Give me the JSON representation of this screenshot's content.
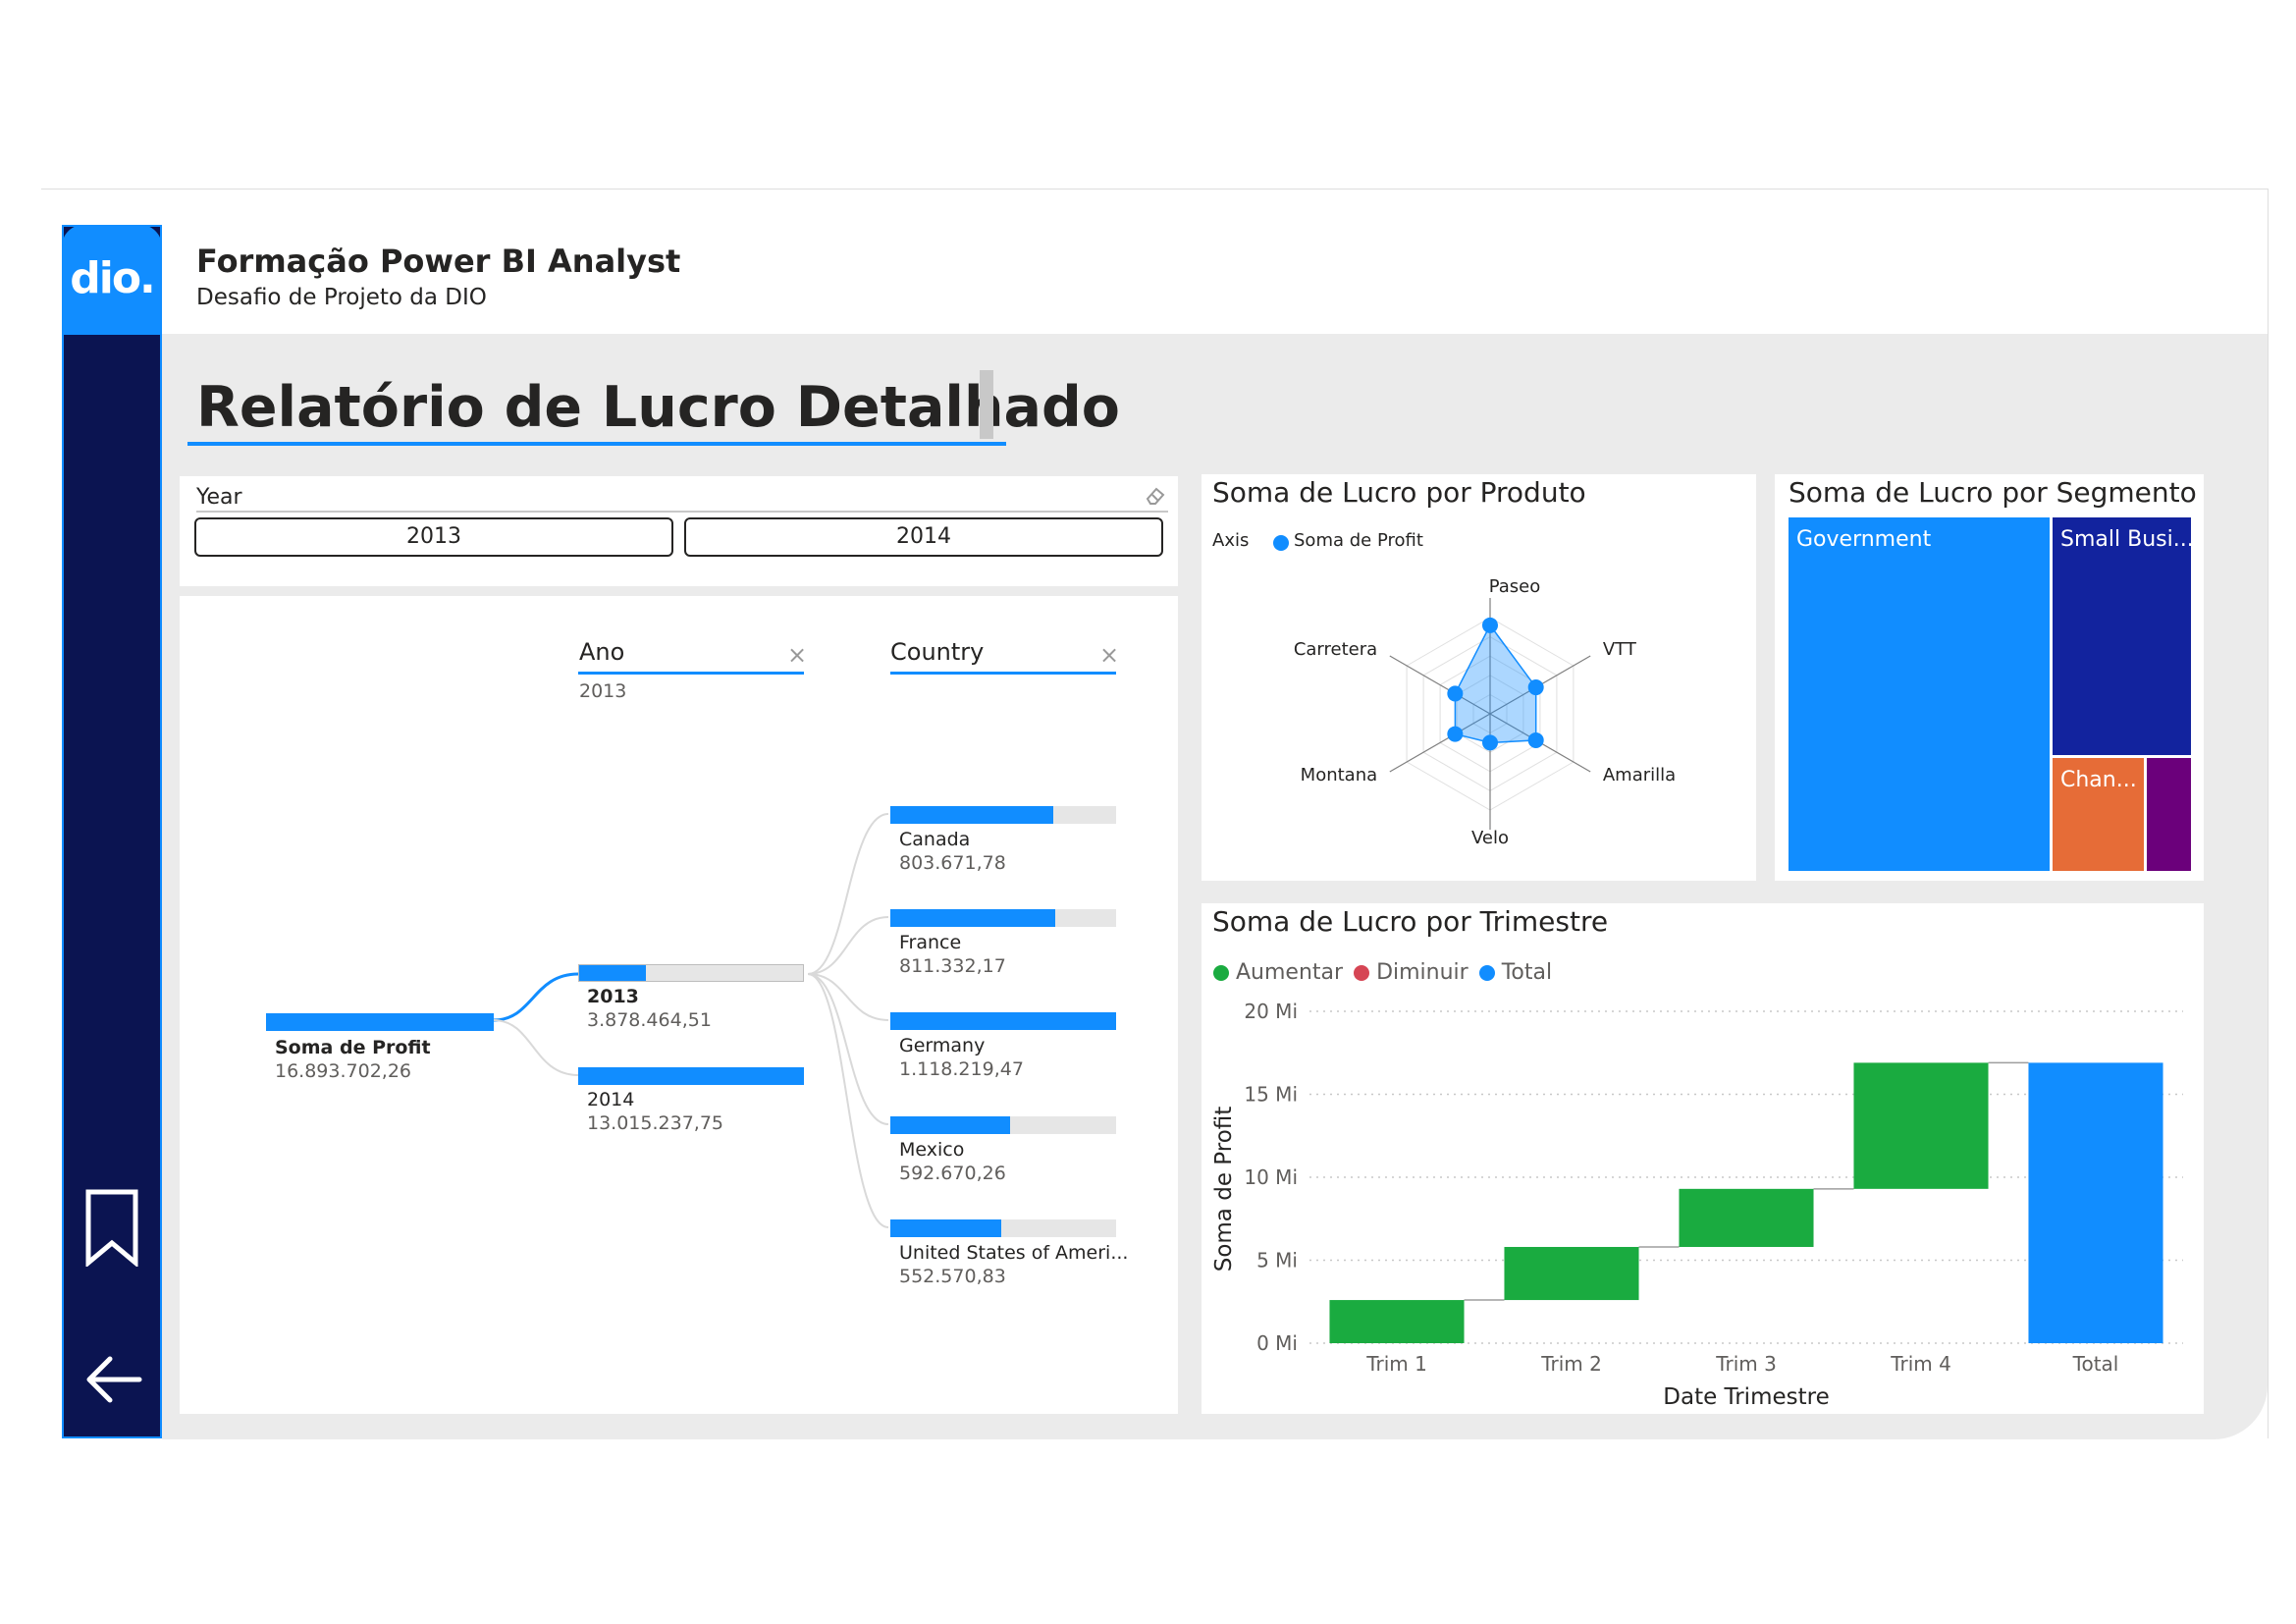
{
  "header": {
    "title": "Formação Power BI Analyst",
    "subtitle": "Desafio de Projeto da DIO",
    "logo_text": "dio."
  },
  "report": {
    "title": "Relatório de Lucro Detalhado"
  },
  "sidebar": {
    "icons": [
      "bookmark-icon",
      "arrow-left-icon"
    ]
  },
  "slicer": {
    "label": "Year",
    "options": [
      "2013",
      "2014"
    ],
    "clear_icon": "eraser-icon"
  },
  "decomposition_tree": {
    "levels": [
      {
        "label": "Ano",
        "selected": "2013",
        "remove_icon": "close-icon"
      },
      {
        "label": "Country",
        "remove_icon": "close-icon"
      }
    ],
    "root": {
      "label": "Soma de Profit",
      "value": "16.893.702,26",
      "fill": 1.0
    },
    "years": [
      {
        "label": "2013",
        "value": "3.878.464,51",
        "fill": 0.3,
        "selected": true
      },
      {
        "label": "2014",
        "value": "13.015.237,75",
        "fill": 1.0,
        "selected": false
      }
    ],
    "countries": [
      {
        "label": "Canada",
        "value": "803.671,78",
        "fill": 0.72
      },
      {
        "label": "France",
        "value": "811.332,17",
        "fill": 0.73
      },
      {
        "label": "Germany",
        "value": "1.118.219,47",
        "fill": 1.0
      },
      {
        "label": "Mexico",
        "value": "592.670,26",
        "fill": 0.53
      },
      {
        "label": "United States of Ameri...",
        "value": "552.570,83",
        "fill": 0.49
      }
    ]
  },
  "radar": {
    "title": "Soma de Lucro por Produto",
    "legend_title": "Axis",
    "legend_item": "Soma de Profit",
    "axes": [
      "Paseo",
      "VTT",
      "Amarilla",
      "Velo",
      "Montana",
      "Carretera"
    ],
    "relative_values": [
      0.92,
      0.55,
      0.55,
      0.3,
      0.42,
      0.42
    ],
    "color": "#118dff"
  },
  "treemap": {
    "title": "Soma de Lucro por Segmento",
    "segments": [
      {
        "label": "Government",
        "color": "#118dff"
      },
      {
        "label": "Small Busi...",
        "color": "#12239e"
      },
      {
        "label": "Chan...",
        "color": "#e66c37"
      },
      {
        "label": "",
        "color": "#6b007b"
      }
    ]
  },
  "chart_data": {
    "type": "waterfall",
    "title": "Soma de Lucro por Trimestre",
    "xlabel": "Date Trimestre",
    "ylabel": "Soma de Profit",
    "legend": [
      {
        "name": "Aumentar",
        "color": "#1aab40"
      },
      {
        "name": "Diminuir",
        "color": "#d64554"
      },
      {
        "name": "Total",
        "color": "#118dff"
      }
    ],
    "categories": [
      "Trim 1",
      "Trim 2",
      "Trim 3",
      "Trim 4",
      "Total"
    ],
    "values": [
      2.6,
      3.2,
      3.5,
      7.6,
      16.9
    ],
    "units": "Mi",
    "ylim": [
      0,
      20
    ],
    "yticks": [
      "0 Mi",
      "5 Mi",
      "10 Mi",
      "15 Mi",
      "20 Mi"
    ],
    "ytick_values": [
      0,
      5,
      10,
      15,
      20
    ],
    "grid": true
  }
}
